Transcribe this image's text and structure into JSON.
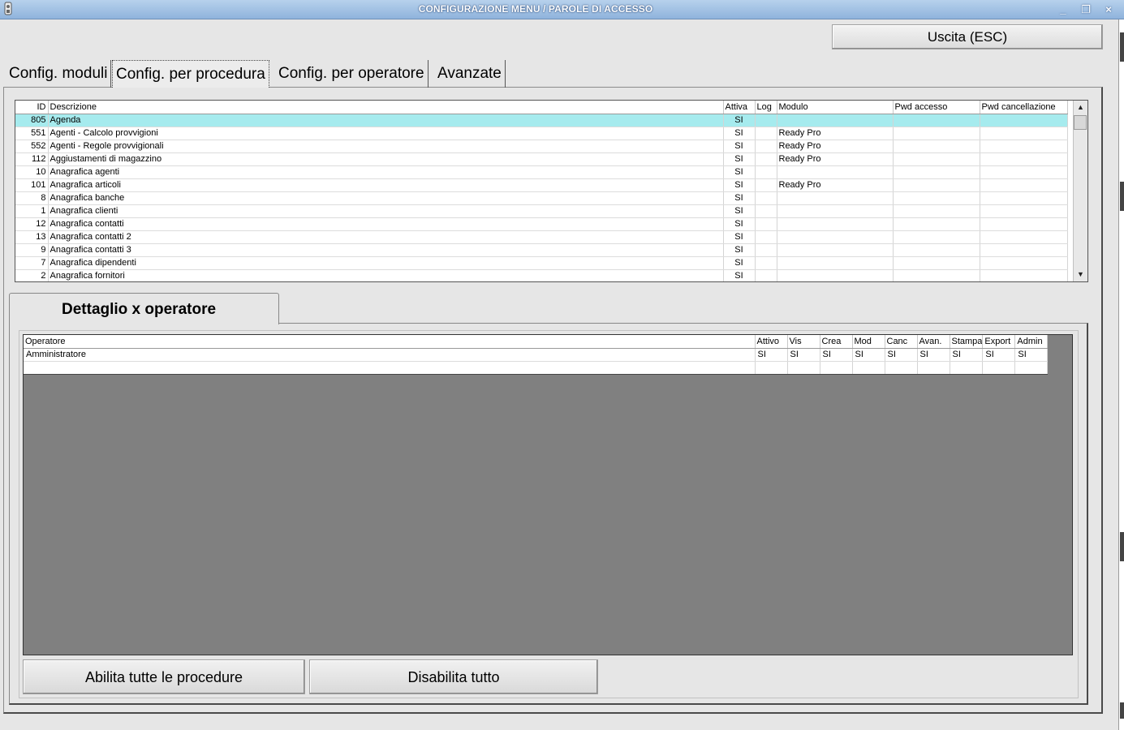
{
  "window": {
    "title": "CONFIGURAZIONE MENU / PAROLE DI ACCESSO",
    "minimize": "_",
    "restore": "❐",
    "close": "×"
  },
  "exit_button": "Uscita (ESC)",
  "tabs": [
    {
      "label": "Config. moduli"
    },
    {
      "label": "Config. per procedura"
    },
    {
      "label": "Config. per operatore"
    },
    {
      "label": "Avanzate"
    }
  ],
  "procedure_grid": {
    "headers": [
      "ID",
      "Descrizione",
      "Attiva",
      "Log",
      "Modulo",
      "Pwd accesso",
      "Pwd cancellazione"
    ],
    "rows": [
      {
        "id": "805",
        "desc": "Agenda",
        "attiva": "SI",
        "log": "",
        "modulo": "",
        "pwd": "",
        "pwdc": ""
      },
      {
        "id": "551",
        "desc": "Agenti - Calcolo provvigioni",
        "attiva": "SI",
        "log": "",
        "modulo": "Ready Pro",
        "pwd": "",
        "pwdc": ""
      },
      {
        "id": "552",
        "desc": "Agenti - Regole provvigionali",
        "attiva": "SI",
        "log": "",
        "modulo": "Ready Pro",
        "pwd": "",
        "pwdc": ""
      },
      {
        "id": "112",
        "desc": "Aggiustamenti di magazzino",
        "attiva": "SI",
        "log": "",
        "modulo": "Ready Pro",
        "pwd": "",
        "pwdc": ""
      },
      {
        "id": "10",
        "desc": "Anagrafica agenti",
        "attiva": "SI",
        "log": "",
        "modulo": "",
        "pwd": "",
        "pwdc": ""
      },
      {
        "id": "101",
        "desc": "Anagrafica articoli",
        "attiva": "SI",
        "log": "",
        "modulo": "Ready Pro",
        "pwd": "",
        "pwdc": ""
      },
      {
        "id": "8",
        "desc": "Anagrafica banche",
        "attiva": "SI",
        "log": "",
        "modulo": "",
        "pwd": "",
        "pwdc": ""
      },
      {
        "id": "1",
        "desc": "Anagrafica clienti",
        "attiva": "SI",
        "log": "",
        "modulo": "",
        "pwd": "",
        "pwdc": ""
      },
      {
        "id": "12",
        "desc": "Anagrafica contatti",
        "attiva": "SI",
        "log": "",
        "modulo": "",
        "pwd": "",
        "pwdc": ""
      },
      {
        "id": "13",
        "desc": "Anagrafica contatti 2",
        "attiva": "SI",
        "log": "",
        "modulo": "",
        "pwd": "",
        "pwdc": ""
      },
      {
        "id": "9",
        "desc": "Anagrafica contatti 3",
        "attiva": "SI",
        "log": "",
        "modulo": "",
        "pwd": "",
        "pwdc": ""
      },
      {
        "id": "7",
        "desc": "Anagrafica dipendenti",
        "attiva": "SI",
        "log": "",
        "modulo": "",
        "pwd": "",
        "pwdc": ""
      },
      {
        "id": "2",
        "desc": "Anagrafica fornitori",
        "attiva": "SI",
        "log": "",
        "modulo": "",
        "pwd": "",
        "pwdc": ""
      }
    ]
  },
  "detail": {
    "tab_label": "Dettaglio x operatore",
    "headers": [
      "Operatore",
      "Attivo",
      "Vis",
      "Crea",
      "Mod",
      "Canc",
      "Avan.",
      "Stampa",
      "Export",
      "Admin"
    ],
    "rows": [
      [
        "Amministratore",
        "SI",
        "SI",
        "SI",
        "SI",
        "SI",
        "SI",
        "SI",
        "SI",
        "SI"
      ]
    ]
  },
  "buttons": {
    "enable_all": "Abilita tutte le procedure",
    "disable_all": "Disabilita tutto"
  }
}
